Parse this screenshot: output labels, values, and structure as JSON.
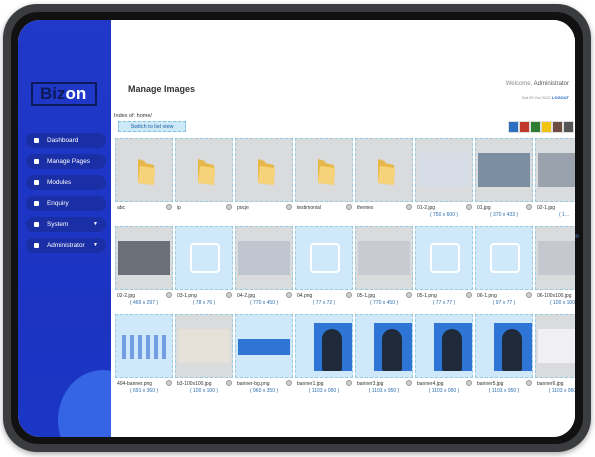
{
  "app": {
    "logo_part1": "Biz",
    "logo_part2": "on"
  },
  "sidebar": {
    "items": [
      {
        "label": "Dashboard",
        "icon": "dashboard-icon"
      },
      {
        "label": "Manage Pages",
        "icon": "page-icon"
      },
      {
        "label": "Modules",
        "icon": "page-icon"
      },
      {
        "label": "Enquiry",
        "icon": "page-icon"
      },
      {
        "label": "System",
        "icon": "gear-icon",
        "caret": "▼"
      },
      {
        "label": "Administrator",
        "icon": "user-icon",
        "caret": "▼"
      }
    ]
  },
  "header": {
    "title": "Manage Images",
    "welcome_prefix": "Welcome, ",
    "welcome_user": "Administrator",
    "datetime": "Sat 29 Oct 2022 ",
    "logout": "LOGOUT"
  },
  "content": {
    "index_label": "Index of:",
    "index_path": "home/",
    "switch_label": "Switch to list view",
    "swatch_colors": [
      "#2f6fbf",
      "#c0392b",
      "#2e7d32",
      "#f1c40f",
      "#6d4c41",
      "#555555"
    ]
  },
  "images": [
    {
      "name": "abc",
      "size": "",
      "kind": "folder"
    },
    {
      "name": "ip",
      "size": "",
      "kind": "folder"
    },
    {
      "name": "pocje",
      "size": "",
      "kind": "folder"
    },
    {
      "name": "testimonial",
      "size": "",
      "kind": "folder"
    },
    {
      "name": "themes",
      "size": "",
      "kind": "folder"
    },
    {
      "name": "01-2.jpg",
      "size": "( 750 x 600 )",
      "kind": "photo",
      "bg": "#d7dde6"
    },
    {
      "name": "01.jpg",
      "size": "( 370 x 433 )",
      "kind": "photo",
      "bg": "#7b8ea2"
    },
    {
      "name": "02-1.jpg",
      "size": "( 1...",
      "kind": "photo",
      "bg": "#9aa3ad"
    },
    {
      "name": "02-2.jpg",
      "size": "( 466 x 297 )",
      "kind": "photo",
      "bg": "#6a6f78"
    },
    {
      "name": "03-1.png",
      "size": "( 78 x 76 )",
      "kind": "logo",
      "bg": "#cfe9fa"
    },
    {
      "name": "04-2.jpg",
      "size": "( 770 x 450 )",
      "kind": "photo",
      "bg": "#bfc6cf"
    },
    {
      "name": "04.png",
      "size": "( 77 x 72 )",
      "kind": "logo",
      "bg": "#cfe9fa"
    },
    {
      "name": "05-1.jpg",
      "size": "( 770 x 450 )",
      "kind": "photo",
      "bg": "#c8ccd2"
    },
    {
      "name": "05-1.png",
      "size": "( 77 x 77 )",
      "kind": "logo",
      "bg": "#cfe9fa"
    },
    {
      "name": "06-1.png",
      "size": "( 97 x 77 )",
      "kind": "logo",
      "bg": "#cfe9fa"
    },
    {
      "name": "06-100x100.jpg",
      "size": "( 100 x 100 )",
      "kind": "photo",
      "bg": "#c5c9cf"
    },
    {
      "name": "404-banner.png",
      "size": "( 691 x 360 )",
      "kind": "illustration",
      "bg": "#cfe9fa"
    },
    {
      "name": "b3-100x100.jpg",
      "size": "( 100 x 100 )",
      "kind": "photo",
      "bg": "#e6e1d8"
    },
    {
      "name": "banner-bg.png",
      "size": "( 960 x 350 )",
      "kind": "banner",
      "bg": "#cfe9fa"
    },
    {
      "name": "banner1.jpg",
      "size": "( 1103 x 950 )",
      "kind": "person",
      "bg": "#2f75d6"
    },
    {
      "name": "banner3.jpg",
      "size": "( 1103 x 950 )",
      "kind": "person",
      "bg": "#2f75d6"
    },
    {
      "name": "banner4.jpg",
      "size": "( 1103 x 950 )",
      "kind": "person",
      "bg": "#2f75d6"
    },
    {
      "name": "banner5.jpg",
      "size": "( 1103 x 950 )",
      "kind": "person",
      "bg": "#2f75d6"
    },
    {
      "name": "banner6.jpg",
      "size": "( 1103 x 950 )",
      "kind": "photo",
      "bg": "#f0f0f2"
    }
  ]
}
